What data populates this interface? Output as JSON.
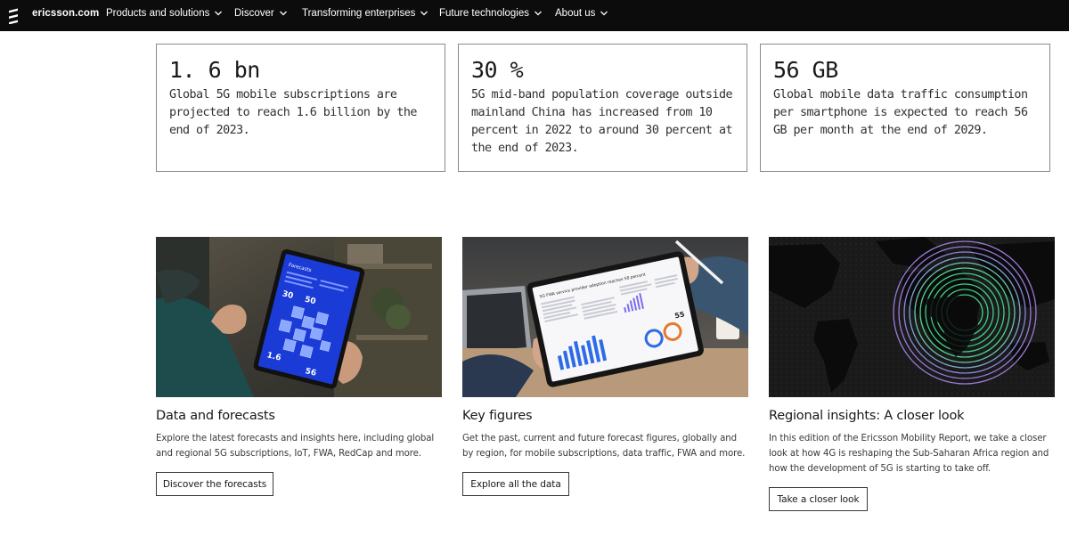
{
  "nav": {
    "logo_icon": "ericsson-logo-icon",
    "brand": "ericsson.com",
    "items": [
      {
        "label": "Products and solutions"
      },
      {
        "label": "Discover"
      },
      {
        "label": "Transforming enterprises"
      },
      {
        "label": "Future technologies"
      },
      {
        "label": "About us"
      }
    ]
  },
  "stats": [
    {
      "value": "1. 6 bn",
      "description": "Global 5G mobile subscriptions are projected to reach 1.6 billion by the end of 2023."
    },
    {
      "value": "30 %",
      "description": "5G mid-band population coverage outside mainland China has increased from 10 percent in 2022 to around 30 percent at the end of 2023."
    },
    {
      "value": "56 GB",
      "description": "Global mobile data traffic consumption per smartphone is expected to reach 56 GB per month at the end of 2029."
    }
  ],
  "cards": [
    {
      "title": "Data and forecasts",
      "description": "Explore the latest forecasts and insights here, including global and regional 5G subscriptions, IoT, FWA, RedCap and more.",
      "button": "Discover the forecasts",
      "image": {
        "tablet_heading": "Forecasts",
        "tablet_num_1": "30",
        "tablet_num_2": "50",
        "tablet_num_3": "1.6",
        "tablet_num_4": "56"
      }
    },
    {
      "title": "Key figures",
      "description": "Get the past, current and future forecast figures, globally and by region, for mobile subscriptions, data traffic, FWA and more.",
      "button": "Explore all the data",
      "image": {
        "tablet_heading": "5G FWA service provider adoption reaches 58 percent",
        "tablet_percent": "55"
      }
    },
    {
      "title": "Regional insights: A closer look",
      "description": "In this edition of the Ericsson Mobility Report, we take a closer look at how 4G is reshaping the Sub-Saharan Africa region and how the development of 5G is starting to take off.",
      "button": "Take a closer look"
    }
  ],
  "colors": {
    "nav_bg": "#0c0c0c",
    "border": "#8a8a8a",
    "accent_blue": "#1b3bd6",
    "accent_green": "#3fd08a",
    "accent_purple": "#8b5cf6"
  }
}
